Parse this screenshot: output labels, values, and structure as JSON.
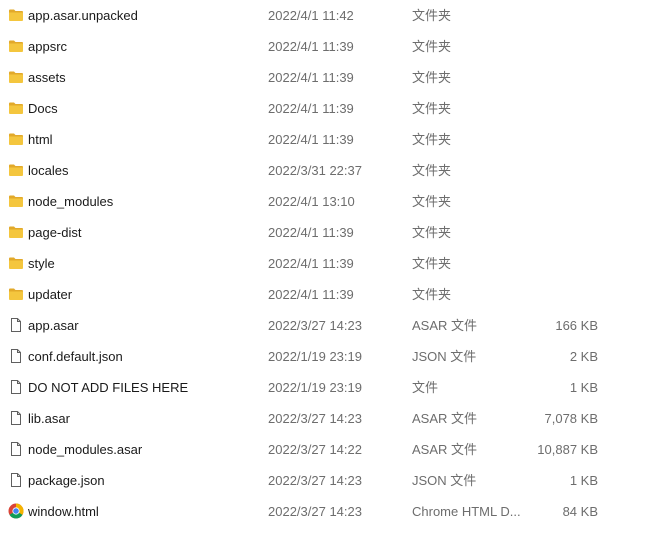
{
  "colors": {
    "folder": "#f4c63e",
    "folder_dark": "#e2a92a",
    "file_outline": "#5f5f5f",
    "text": "#1a1a1a",
    "muted_text": "#6d6d6d"
  },
  "files": [
    {
      "name": "app.asar.unpacked",
      "modified": "2022/4/1 11:42",
      "type": "文件夹",
      "size": "",
      "icon": "folder-icon"
    },
    {
      "name": "appsrc",
      "modified": "2022/4/1 11:39",
      "type": "文件夹",
      "size": "",
      "icon": "folder-icon"
    },
    {
      "name": "assets",
      "modified": "2022/4/1 11:39",
      "type": "文件夹",
      "size": "",
      "icon": "folder-icon"
    },
    {
      "name": "Docs",
      "modified": "2022/4/1 11:39",
      "type": "文件夹",
      "size": "",
      "icon": "folder-icon"
    },
    {
      "name": "html",
      "modified": "2022/4/1 11:39",
      "type": "文件夹",
      "size": "",
      "icon": "folder-icon"
    },
    {
      "name": "locales",
      "modified": "2022/3/31 22:37",
      "type": "文件夹",
      "size": "",
      "icon": "folder-icon"
    },
    {
      "name": "node_modules",
      "modified": "2022/4/1 13:10",
      "type": "文件夹",
      "size": "",
      "icon": "folder-icon"
    },
    {
      "name": "page-dist",
      "modified": "2022/4/1 11:39",
      "type": "文件夹",
      "size": "",
      "icon": "folder-icon"
    },
    {
      "name": "style",
      "modified": "2022/4/1 11:39",
      "type": "文件夹",
      "size": "",
      "icon": "folder-icon"
    },
    {
      "name": "updater",
      "modified": "2022/4/1 11:39",
      "type": "文件夹",
      "size": "",
      "icon": "folder-icon"
    },
    {
      "name": "app.asar",
      "modified": "2022/3/27 14:23",
      "type": "ASAR 文件",
      "size": "166 KB",
      "icon": "file-icon"
    },
    {
      "name": "conf.default.json",
      "modified": "2022/1/19 23:19",
      "type": "JSON 文件",
      "size": "2 KB",
      "icon": "file-icon"
    },
    {
      "name": "DO NOT ADD FILES HERE",
      "modified": "2022/1/19 23:19",
      "type": "文件",
      "size": "1 KB",
      "icon": "file-icon"
    },
    {
      "name": "lib.asar",
      "modified": "2022/3/27 14:23",
      "type": "ASAR 文件",
      "size": "7,078 KB",
      "icon": "file-icon"
    },
    {
      "name": "node_modules.asar",
      "modified": "2022/3/27 14:22",
      "type": "ASAR 文件",
      "size": "10,887 KB",
      "icon": "file-icon"
    },
    {
      "name": "package.json",
      "modified": "2022/3/27 14:23",
      "type": "JSON 文件",
      "size": "1 KB",
      "icon": "file-icon"
    },
    {
      "name": "window.html",
      "modified": "2022/3/27 14:23",
      "type": "Chrome HTML D...",
      "size": "84 KB",
      "icon": "chrome-html-icon"
    }
  ]
}
